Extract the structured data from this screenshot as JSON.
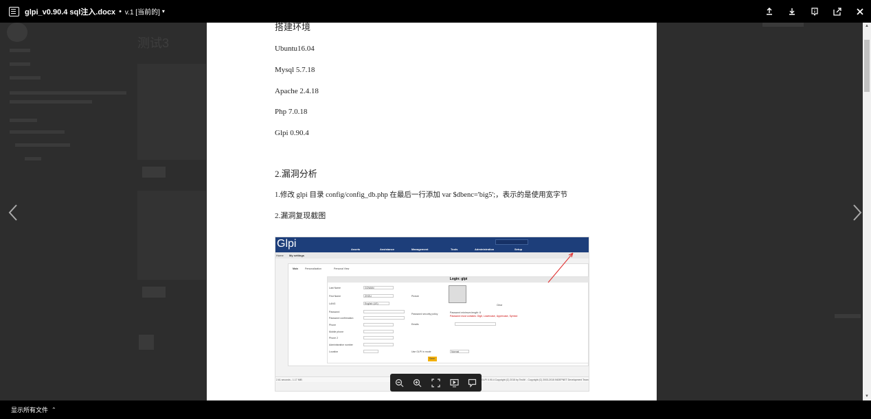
{
  "topbar": {
    "file_title": "glpi_v0.90.4 sql注入.docx",
    "separator": "•",
    "version": "v.1 [当前的]",
    "caret": "▾",
    "actions": [
      "share-icon",
      "download-icon",
      "info-icon",
      "open-external-icon",
      "close-icon"
    ]
  },
  "document": {
    "lines": [
      "搭建环境",
      "Ubuntu16.04",
      "Mysql 5.7.18",
      "Apache 2.4.18",
      "Php 7.0.18",
      "Glpi 0.90.4",
      "2.漏洞分析",
      "1.修改 glpi 目录 config/config_db.php 在最后一行添加 var $dbenc='big5';，表示的是使用宽字节",
      "2.漏洞复现截图"
    ],
    "screenshot": {
      "logo": "Glpi",
      "nav": [
        "Assets",
        "Assistance",
        "Management",
        "Tools",
        "Administration",
        "Setup"
      ],
      "search_placeholder": "Search",
      "lang": "English (US)",
      "tabs": [
        "Home",
        "My settings"
      ],
      "subtabs": [
        "Main",
        "Personalization",
        "Personal View"
      ],
      "form_title": "Login: glpi",
      "fields": [
        "Last Name",
        "First Name",
        "LANG",
        "Password",
        "Password confirmation",
        "Phone",
        "Mobile phone",
        "Phone 2",
        "Administrative number",
        "Location"
      ],
      "right_fields": [
        "Picture",
        "Password security policy",
        "Emails",
        "Use GLPI in mode"
      ],
      "field_values": {
        "last_name": "GOWAN",
        "first_name": "ZHOU",
        "lang_value": "English (US)",
        "mode_value": "Normal"
      },
      "password_policy": "Password minimum length: 8",
      "password_policy_2": "Password must contains: Digit, Lowercase, Uppercase, Symbol",
      "clear_label": "Clear",
      "save_label": "Save",
      "footer_left": "2.61 seconds - 1.17 MiB",
      "footer_right": "GLPI 0.90.4 Copyright (C) 2015 by Teclib' - Copyright (C) 2003-2015 INDEPNET Development Team"
    }
  },
  "zoom_tools": [
    "zoom-out-icon",
    "zoom-in-icon",
    "fit-screen-icon",
    "present-icon",
    "comment-icon"
  ],
  "bottombar": {
    "show_all": "显示所有文件",
    "chevron": "⌃"
  },
  "background": {
    "page_title": "测试3"
  },
  "colors": {
    "topbar": "#000000",
    "glpi_header": "#1d3e7a",
    "save_button": "#f2b00b",
    "red_arrow": "#e03030"
  }
}
